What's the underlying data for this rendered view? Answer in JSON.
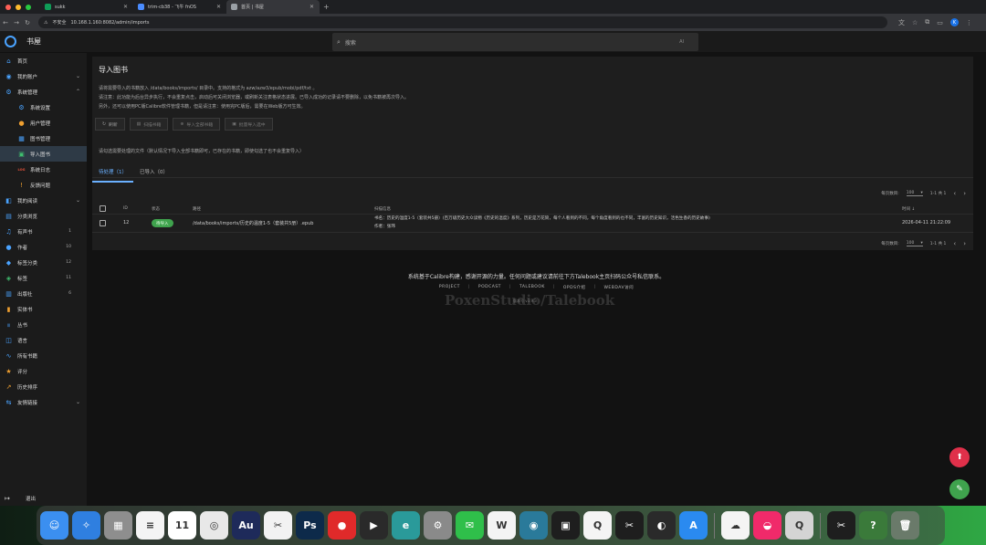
{
  "browser": {
    "tabs": [
      {
        "label": "sukk",
        "fav_color": "#0f9d58",
        "active": false
      },
      {
        "label": "trim-cb38 - 飞牛 fnOS",
        "fav_color": "#4a8cff",
        "active": false
      },
      {
        "label": "首页 | 书屋",
        "fav_color": "#9aa0a6",
        "active": true
      }
    ],
    "new_tab": "+",
    "security": "不安全",
    "url": "10.168.1.160:8082/admin/imports",
    "profile_initial": "K"
  },
  "app": {
    "title": "书屋",
    "search_placeholder": "搜索",
    "search_ai": "AI"
  },
  "sidebar": {
    "items": [
      {
        "label": "首页",
        "icon": "⌂",
        "color": "#4aa3ff",
        "sub": false
      },
      {
        "label": "我的账户",
        "icon": "◉",
        "color": "#4aa3ff",
        "sub": false,
        "chev": "⌄"
      },
      {
        "label": "系统管理",
        "icon": "⚙",
        "color": "#4aa3ff",
        "sub": false,
        "chev": "⌃"
      },
      {
        "label": "系统设置",
        "icon": "⚙",
        "color": "#4aa3ff",
        "sub": true
      },
      {
        "label": "用户管理",
        "icon": "●",
        "color": "#f0a030",
        "sub": true
      },
      {
        "label": "图书管理",
        "icon": "▦",
        "color": "#4aa3ff",
        "sub": true
      },
      {
        "label": "导入图书",
        "icon": "▣",
        "color": "#3fbf6f",
        "sub": true,
        "active": true
      },
      {
        "label": "系统日志",
        "icon": "LOG",
        "color": "#e0503a",
        "sub": true
      },
      {
        "label": "反馈问题",
        "icon": "!",
        "color": "#f0a030",
        "sub": true
      },
      {
        "label": "我的阅读",
        "icon": "◧",
        "color": "#4aa3ff",
        "sub": false,
        "chev": "⌄"
      },
      {
        "label": "分类浏览",
        "icon": "▤",
        "color": "#4aa3ff",
        "sub": false
      },
      {
        "label": "有声书",
        "icon": "♫",
        "color": "#4aa3ff",
        "sub": false,
        "count": "1"
      },
      {
        "label": "作者",
        "icon": "●",
        "color": "#4aa3ff",
        "sub": false,
        "count": "10"
      },
      {
        "label": "标签分类",
        "icon": "◆",
        "color": "#4aa3ff",
        "sub": false,
        "count": "12"
      },
      {
        "label": "标签",
        "icon": "◈",
        "color": "#3fbf6f",
        "sub": false,
        "count": "11"
      },
      {
        "label": "出版社",
        "icon": "▥",
        "color": "#4aa3ff",
        "sub": false,
        "count": "6"
      },
      {
        "label": "实体书",
        "icon": "▮",
        "color": "#f0a030",
        "sub": false
      },
      {
        "label": "丛书",
        "icon": "|||",
        "color": "#4aa3ff",
        "sub": false
      },
      {
        "label": "语言",
        "icon": "◫",
        "color": "#4aa3ff",
        "sub": false
      },
      {
        "label": "所有书籍",
        "icon": "∿",
        "color": "#4aa3ff",
        "sub": false
      },
      {
        "label": "评分",
        "icon": "★",
        "color": "#f0a030",
        "sub": false
      },
      {
        "label": "历史排序",
        "icon": "↗",
        "color": "#f0a030",
        "sub": false
      },
      {
        "label": "友情链接",
        "icon": "⇆",
        "color": "#4aa3ff",
        "sub": false,
        "chev": "⌄"
      }
    ],
    "logout": "退出"
  },
  "page": {
    "title": "导入图书",
    "desc": [
      "请将需要导入的书籍放入 /data/books/imports/ 目录中。支持的格式为 azw/azw3/epub/mobi/pdf/txt 。",
      "请注意：此功能为后台异步执行，不会重复点击，启动后可关闭浏览器，或刷新关注表格状态进展。已导入成功的记录请不要删除，以免书籍被再次导入。",
      "另外，还可以使用PC版Calibre软件管理书籍，但是请注意：使用完PC版后，需要在Web版方可生效。"
    ],
    "buttons": {
      "refresh": "刷新",
      "scan": "扫描书籍",
      "import_all": "导入全部书籍",
      "import_selected": "批量导入选中"
    },
    "hint": "请勾选需要处理的文件（默认情况下导入全部书籍即可，已存在的书籍，即使勾选了也不会重复导入）",
    "tabs": [
      {
        "label": "待处理（1）",
        "active": true
      },
      {
        "label": "已导入（0）",
        "active": false
      }
    ],
    "pager": {
      "per_page_label": "每页数目:",
      "per_page": "100",
      "range": "1-1 共 1",
      "prev": "‹",
      "next": "›"
    },
    "table": {
      "headers": {
        "id": "ID",
        "status": "状态",
        "path": "路径",
        "info": "扫描信息",
        "time": "时间"
      },
      "rows": [
        {
          "id": "12",
          "status": "待导入",
          "path": "/data/books/imports/历史的温度1-5（套装共5册）.epub",
          "info_title": "书名：历史的温度1-5（套装共5册）(百万级历史大众读物《历史的温度》系列，历史是万花筒，每个人看到的不同，每个角度看到的也不同，丰富的历史知识，活色生香的历史故事)",
          "info_author": "作者：张玮",
          "time": "2026-04-11 21:22:09"
        }
      ]
    }
  },
  "footer": {
    "text": "系统基于Calibre构建，感谢开源的力量。任何问题或建议请前往下方Talebook主页扫码公众号私信联系。",
    "links": [
      "PROJECT",
      "PODCAST",
      "TALEBOOK",
      "OPDS介绍",
      "WEBDAV访问"
    ],
    "watermark": "PoxenStudio/Talebook",
    "version": "版本号 v3.9.3"
  },
  "dock": {
    "apps": [
      {
        "name": "finder",
        "bg": "#3b8ff0",
        "glyph": "☺"
      },
      {
        "name": "safari",
        "bg": "#2f7fe0",
        "glyph": "✧"
      },
      {
        "name": "launchpad",
        "bg": "#8e8e8e",
        "glyph": "▦"
      },
      {
        "name": "reminders",
        "bg": "#f4f4f4",
        "glyph": "≡"
      },
      {
        "name": "calendar",
        "bg": "#ffffff",
        "glyph": "11"
      },
      {
        "name": "chrome",
        "bg": "#e8e8e8",
        "glyph": "◎"
      },
      {
        "name": "audition",
        "bg": "#1e2a5a",
        "glyph": "Au"
      },
      {
        "name": "capcut",
        "bg": "#f2f2f2",
        "glyph": "✂"
      },
      {
        "name": "photoshop",
        "bg": "#0d2a4a",
        "glyph": "Ps"
      },
      {
        "name": "app-red",
        "bg": "#e02a2a",
        "glyph": "●"
      },
      {
        "name": "final-cut",
        "bg": "#2a2a2a",
        "glyph": "▶"
      },
      {
        "name": "edge",
        "bg": "#2a9a9a",
        "glyph": "e"
      },
      {
        "name": "settings",
        "bg": "#8a8a8a",
        "glyph": "⚙"
      },
      {
        "name": "wechat",
        "bg": "#2fbf4a",
        "glyph": "✉"
      },
      {
        "name": "wps",
        "bg": "#f4f4f4",
        "glyph": "W"
      },
      {
        "name": "app-teal",
        "bg": "#2a7a9a",
        "glyph": "◉"
      },
      {
        "name": "camera",
        "bg": "#1e1e1e",
        "glyph": "▣"
      },
      {
        "name": "qq",
        "bg": "#f4f4f4",
        "glyph": "Q"
      },
      {
        "name": "capcut2",
        "bg": "#1e1e1e",
        "glyph": "✂"
      },
      {
        "name": "obs",
        "bg": "#2a2a2a",
        "glyph": "◐"
      },
      {
        "name": "app-store",
        "bg": "#2a8af0",
        "glyph": "A"
      },
      {
        "name": "baidu-netdisk",
        "bg": "#f4f4f4",
        "glyph": "☁"
      },
      {
        "name": "app-pink",
        "bg": "#f02a6a",
        "glyph": "◒"
      },
      {
        "name": "quicktime",
        "bg": "#d4d4d4",
        "glyph": "Q"
      },
      {
        "name": "capcut3",
        "bg": "#1e1e1e",
        "glyph": "✂"
      },
      {
        "name": "help",
        "bg": "#3a7a3a",
        "glyph": "?"
      },
      {
        "name": "trash",
        "bg": "#6a7a6a",
        "glyph": "🗑"
      }
    ]
  }
}
